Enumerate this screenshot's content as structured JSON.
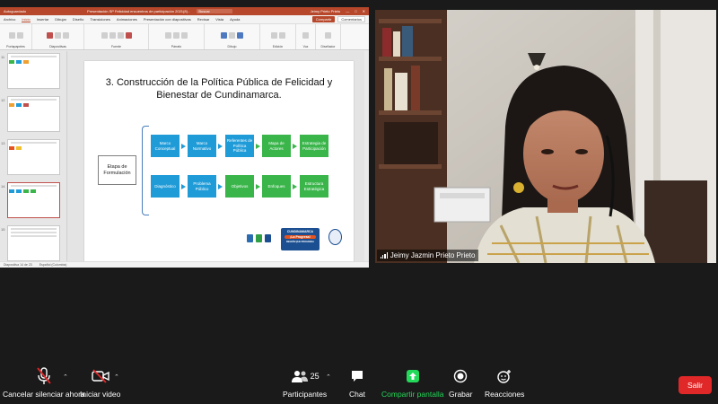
{
  "ppt": {
    "autosave_label": "Autoguardado",
    "window_title": "Presentación SP Felicidad encuentros de participación 2021(8) -",
    "search_label": "Buscar",
    "user_name": "Jeimy Prieto Prieto",
    "tabs": [
      "Archivo",
      "Inicio",
      "Insertar",
      "Dibujar",
      "Diseño",
      "Transiciones",
      "Animaciones",
      "Presentación con diapositivas",
      "Revisar",
      "Vista",
      "Ayuda"
    ],
    "active_tab": "Inicio",
    "share_label": "Compartir",
    "comments_label": "Comentarios",
    "ribbon_groups": [
      "Portapapeles",
      "Diapositivas",
      "Fuente",
      "Párrafo",
      "Dibujo",
      "Edición",
      "Voz",
      "Diseñador"
    ],
    "slide_numbers": [
      "11",
      "12",
      "13",
      "14",
      "15"
    ],
    "status_text": "Diapositiva 14 de 23",
    "status_lang": "Español (Colombia)"
  },
  "slide": {
    "title_line1": "3. Construcción de la Política Pública de Felicidad y",
    "title_line2": "Bienestar de Cundinamarca.",
    "etapa_label": "Etapa de Formulación",
    "row1": [
      "Marco Conceptual",
      "Marco Normativo",
      "Referentes de Política Pública",
      "Mapa de Actores",
      "Estrategia de Participación"
    ],
    "row2": [
      "Diagnóstico",
      "Problema Público",
      "Objetivos",
      "Enfoques",
      "Estructura Estratégica"
    ],
    "logo_text": "CUNDINAMARCA",
    "logo_sub": "¡La Progresa!",
    "logo_tagline": "REGIÓN QUE PROGRESA",
    "colors": {
      "blue": "#1f9bd8",
      "green": "#39b54a"
    }
  },
  "participant": {
    "name": "Jeimy Jazmin Prieto Prieto"
  },
  "toolbar": {
    "unmute_label": "Cancelar silenciar ahora",
    "start_video_label": "Iniciar video",
    "participants_label": "Participantes",
    "participants_count": "25",
    "chat_label": "Chat",
    "share_screen_label": "Compartir pantalla",
    "record_label": "Grabar",
    "reactions_label": "Reacciones",
    "leave_label": "Salir",
    "share_color": "#23d959"
  }
}
